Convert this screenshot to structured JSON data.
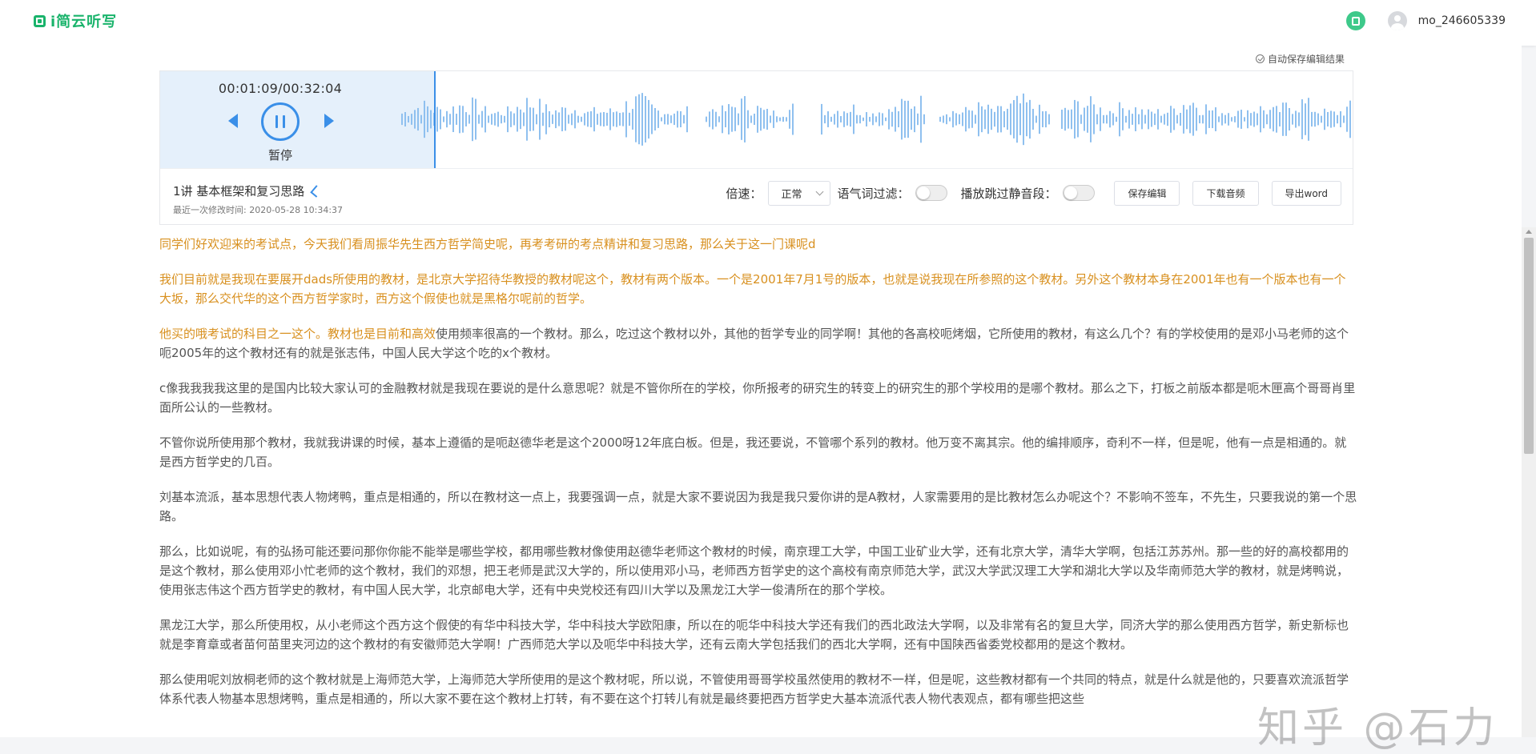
{
  "app": {
    "name": "i简云听写"
  },
  "user": {
    "name": "mo_246605339"
  },
  "autosave_label": "自动保存编辑结果",
  "player": {
    "time": "00:01:09/00:32:04",
    "pause_label": "暂停",
    "progress": 0.036
  },
  "file": {
    "title": "1讲 基本框架和复习思路",
    "modified": "最近一次修改时间: 2020-05-28 10:34:37"
  },
  "controls": {
    "speed_label": "倍速：",
    "speed_value": "正常",
    "filler_label": "语气词过滤：",
    "skip_label": "播放跳过静音段：",
    "save": "保存编辑",
    "download": "下载音频",
    "export": "导出word"
  },
  "colors": {
    "accent": "#3a8fe8",
    "highlight": "#d8901f",
    "brand": "#19b36b"
  },
  "transcript": [
    {
      "hl": "同学们好欢迎来的考试点，今天我们看周振华先生西方哲学简史呢，再考考研的考点精讲和复习思路，那么关于这一门课呢d",
      "rest": ""
    },
    {
      "hl": "我们目前就是我现在要展开dads所使用的教材，是北京大学招待华教授的教材呢这个，教材有两个版本。一个是2001年7月1号的版本，也就是说我现在所参照的这个教材。另外这个教材本身在2001年也有一个版本也有一个大坂，那么交代华的这个西方哲学家时，西方这个假使也就是黑格尔呢前的哲学。",
      "rest": ""
    },
    {
      "hl": "他买的哦考试的科目之一这个。教材也是目前和高效",
      "rest": "使用频率很高的一个教材。那么，吃过这个教材以外，其他的哲学专业的同学啊！其他的各高校呃烤烟，它所使用的教材，有这么几个？有的学校使用的是邓小马老师的这个呃2005年的这个教材还有的就是张志伟，中国人民大学这个吃的x个教材。"
    },
    {
      "hl": "",
      "rest": "c像我我我我这里的是国内比较大家认可的金融教材就是我现在要说的是什么意思呢？就是不管你所在的学校，你所报考的研究生的转变上的研究生的那个学校用的是哪个教材。那么之下，打板之前版本都是呃木匣高个哥哥肖里面所公认的一些教材。"
    },
    {
      "hl": "",
      "rest": "不管你说所使用那个教材，我就我讲课的时候，基本上遵循的是呃赵德华老是这个2000呀12年底白板。但是，我还要说，不管哪个系列的教材。他万变不离其宗。他的编排顺序，奇利不一样，但是呢，他有一点是相通的。就是西方哲学史的几百。"
    },
    {
      "hl": "",
      "rest": "刘基本流派，基本思想代表人物烤鸭，重点是相通的，所以在教材这一点上，我要强调一点，就是大家不要说因为我是我只爱你讲的是A教材，人家需要用的是比教材怎么办呢这个？不影响不签车，不先生，只要我说的第一个思路。"
    },
    {
      "hl": "",
      "rest": "那么，比如说呢，有的弘扬可能还要问那你你能不能举是哪些学校，都用哪些教材像使用赵德华老师这个教材的时候，南京理工大学，中国工业矿业大学，还有北京大学，清华大学啊，包括江苏苏州。那一些的好的高校都用的是这个教材，那么使用邓小忙老师的这个教材，我们的邓想，把王老师是武汉大学的，所以使用邓小马，老师西方哲学史的这个高校有南京师范大学，武汉大学武汉理工大学和湖北大学以及华南师范大学的教材，就是烤鸭说，使用张志伟这个西方哲学史的教材，有中国人民大学，北京邮电大学，还有中央党校还有四川大学以及黑龙江大学一俊清所在的那个学校。"
    },
    {
      "hl": "",
      "rest": "黑龙江大学，那么所使用权，从小老师这个西方这个假使的有华中科技大学，华中科技大学欧阳康，所以在的呃华中科技大学还有我们的西北政法大学啊，以及非常有名的复旦大学，同济大学的那么使用西方哲学，新史新标也就是李育章或者苗何苗里夹河边的这个教材的有安徽师范大学啊！广西师范大学以及呃华中科技大学，还有云南大学包括我们的西北大学啊，还有中国陕西省委党校都用的是这个教材。"
    },
    {
      "hl": "",
      "rest": "那么使用呢刘放桐老师的这个教材就是上海师范大学，上海师范大学所使用的是这个教材呢，所以说，不管使用哥哥学校虽然使用的教材不一样，但是呢，这些教材都有一个共同的特点，就是什么就是他的，只要喜欢流派哲学体系代表人物基本思想烤鸭，重点是相通的，所以大家不要在这个教材上打转，有不要在这个打转儿有就是最终要把西方哲学史大基本流派代表人物代表观点，都有哪些把这些"
    }
  ],
  "watermark": "知乎 @石力"
}
